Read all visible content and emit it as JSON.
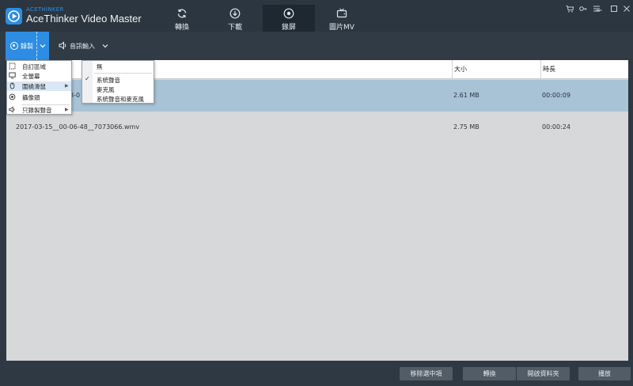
{
  "app": {
    "brand_small": "ACETHINKER",
    "title": "AceThinker Video Master"
  },
  "tabs": [
    {
      "label": "轉換",
      "icon": "refresh-icon"
    },
    {
      "label": "下載",
      "icon": "download-icon"
    },
    {
      "label": "錄屏",
      "icon": "record-icon",
      "active": true
    },
    {
      "label": "圖片MV",
      "icon": "tv-icon"
    }
  ],
  "toolbar": {
    "record_label": "錄製",
    "audio_label": "音訊輸入"
  },
  "table": {
    "columns": [
      "",
      "大小",
      "時長"
    ],
    "rows": [
      {
        "name": "8-0",
        "size": "2.61 MB",
        "duration": "00:00:09",
        "selected": true
      },
      {
        "name": "2017-03-15__00-06-48__7073066.wmv",
        "size": "2.75 MB",
        "duration": "00:00:24",
        "selected": false
      }
    ]
  },
  "record_menu": {
    "items": [
      {
        "label": "自訂區域",
        "icon": "region-icon"
      },
      {
        "label": "全螢幕",
        "icon": "monitor-icon"
      },
      {
        "label": "圍繞滑鼠",
        "icon": "mouse-icon",
        "submenu": true,
        "hover": true
      },
      {
        "label": "攝像頭",
        "icon": "webcam-icon"
      },
      {
        "label": "只錄製聲音",
        "icon": "speaker-icon",
        "submenu": true
      }
    ]
  },
  "audio_submenu": {
    "items": [
      {
        "label": "無",
        "checked": false
      },
      {
        "label": "系統聲音",
        "checked": true
      },
      {
        "label": "麥克風",
        "checked": false
      },
      {
        "label": "系統聲音和麥克風",
        "checked": false
      }
    ]
  },
  "bottom": {
    "remove_label": "移除選中項",
    "convert_label": "轉換",
    "open_folder_label": "開啟資料夾",
    "play_label": "播放"
  },
  "colors": {
    "accent": "#2d8de3",
    "titlebar": "#2b3640",
    "selected_row": "#a8c3d6"
  }
}
